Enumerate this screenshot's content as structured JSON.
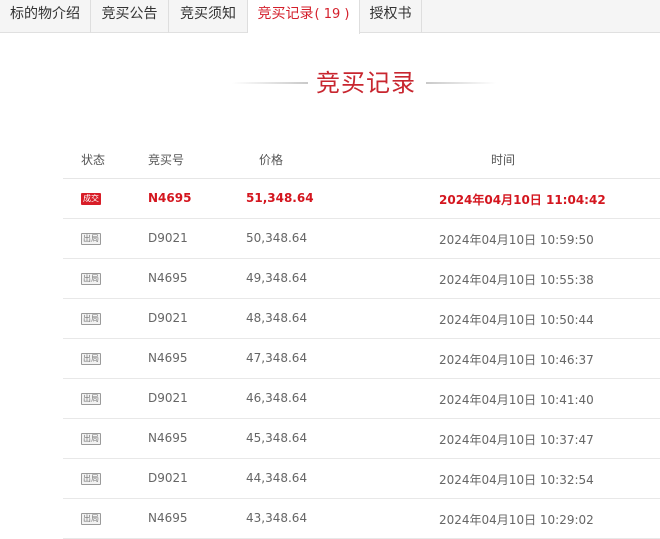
{
  "tabs": [
    {
      "label": "标的物介绍"
    },
    {
      "label": "竞买公告"
    },
    {
      "label": "竞买须知"
    },
    {
      "label": "竞买记录",
      "count": "( 19 )"
    },
    {
      "label": "授权书"
    }
  ],
  "section_title": "竞买记录",
  "table": {
    "headers": {
      "status": "状态",
      "bidder": "竞买号",
      "price": "价格",
      "time": "时间"
    },
    "rows": [
      {
        "status": "成交",
        "bidder": "N4695",
        "price": "51,348.64",
        "time": "2024年04月10日 11:04:42"
      },
      {
        "status": "出局",
        "bidder": "D9021",
        "price": "50,348.64",
        "time": "2024年04月10日 10:59:50"
      },
      {
        "status": "出局",
        "bidder": "N4695",
        "price": "49,348.64",
        "time": "2024年04月10日 10:55:38"
      },
      {
        "status": "出局",
        "bidder": "D9021",
        "price": "48,348.64",
        "time": "2024年04月10日 10:50:44"
      },
      {
        "status": "出局",
        "bidder": "N4695",
        "price": "47,348.64",
        "time": "2024年04月10日 10:46:37"
      },
      {
        "status": "出局",
        "bidder": "D9021",
        "price": "46,348.64",
        "time": "2024年04月10日 10:41:40"
      },
      {
        "status": "出局",
        "bidder": "N4695",
        "price": "45,348.64",
        "time": "2024年04月10日 10:37:47"
      },
      {
        "status": "出局",
        "bidder": "D9021",
        "price": "44,348.64",
        "time": "2024年04月10日 10:32:54"
      },
      {
        "status": "出局",
        "bidder": "N4695",
        "price": "43,348.64",
        "time": "2024年04月10日 10:29:02"
      }
    ]
  },
  "colors": {
    "accent": "#d41f2b",
    "tab_bg": "#f5f5f5",
    "badge_out_border": "#9a9a9a"
  }
}
